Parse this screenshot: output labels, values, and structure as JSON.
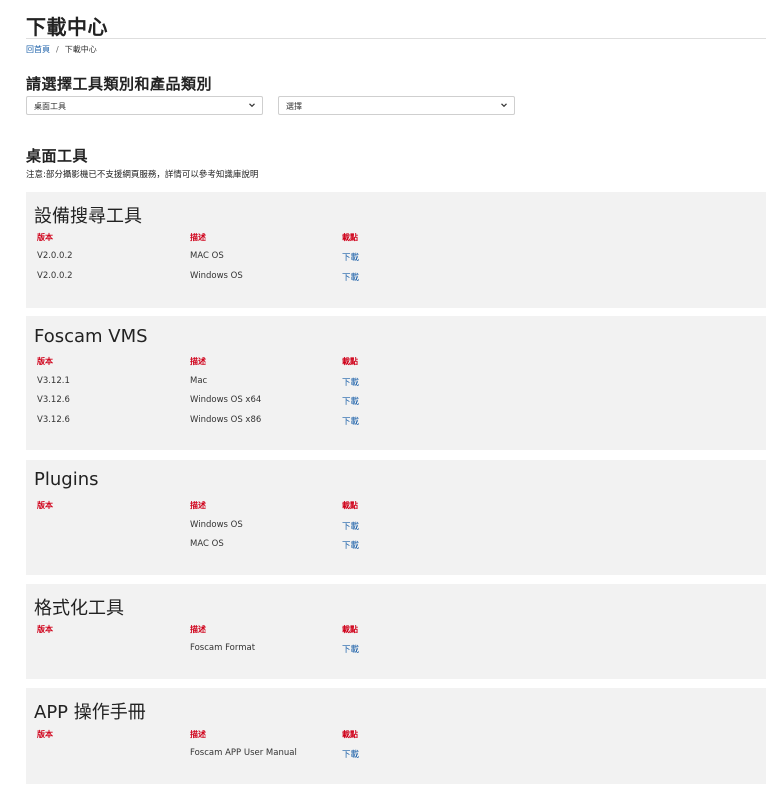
{
  "page": {
    "title": "下載中心",
    "breadcrumb": {
      "home": "回首頁",
      "separator": "/",
      "current": "下載中心"
    }
  },
  "filters": {
    "heading": "請選擇工具類別和產品類別",
    "category_value": "桌面工具",
    "product_value": "選擇"
  },
  "category": {
    "title": "桌面工具",
    "note": "注意:部分攝影機已不支援網頁服務，詳情可以參考知識庫說明"
  },
  "table_headers": {
    "version": "版本",
    "description": "描述",
    "download": "載點"
  },
  "products": [
    {
      "title": "設備搜尋工具",
      "rows": [
        {
          "version": "V2.0.0.2",
          "description": "MAC OS",
          "download": "下載"
        },
        {
          "version": "V2.0.0.2",
          "description": "Windows OS",
          "download": "下載"
        }
      ]
    },
    {
      "title": "Foscam VMS",
      "rows": [
        {
          "version": "V3.12.1",
          "description": "Mac",
          "download": "下載"
        },
        {
          "version": "V3.12.6",
          "description": "Windows OS x64",
          "download": "下載"
        },
        {
          "version": "V3.12.6",
          "description": "Windows OS x86",
          "download": "下載"
        }
      ]
    },
    {
      "title": "Plugins",
      "rows": [
        {
          "version": "",
          "description": "Windows OS",
          "download": "下載"
        },
        {
          "version": "",
          "description": "MAC OS",
          "download": "下載"
        }
      ]
    },
    {
      "title": "格式化工具",
      "rows": [
        {
          "version": "",
          "description": "Foscam Format",
          "download": "下載"
        }
      ]
    },
    {
      "title": "APP 操作手冊",
      "rows": [
        {
          "version": "",
          "description": "Foscam APP User Manual",
          "download": "下載"
        }
      ]
    }
  ]
}
